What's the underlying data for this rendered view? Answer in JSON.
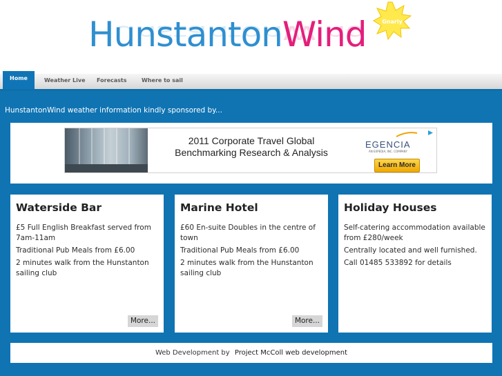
{
  "header": {
    "logo_part1": "Hunstanton",
    "logo_part2": "Wind",
    "badge": "Gnarly"
  },
  "nav": {
    "items": [
      {
        "label": "Home",
        "active": true
      },
      {
        "label": "Weather Live"
      },
      {
        "label": "Forecasts"
      },
      {
        "label": "Where to sail"
      }
    ]
  },
  "sponsor_note": "HunstantonWind weather information kindly sponsored by...",
  "ad": {
    "headline_line1": "2011 Corporate Travel Global",
    "headline_line2": "Benchmarking Research & Analysis",
    "brand": "EGENCIA",
    "brand_sub": "AN EXPEDIA, INC. COMPANY",
    "cta": "Learn More"
  },
  "cards": [
    {
      "title": "Waterside Bar",
      "lines": [
        "£5 Full English Breakfast served from 7am-11am",
        "Traditional Pub Meals from £6.00",
        "2 minutes walk from the Hunstanton sailing club"
      ],
      "more": "More..."
    },
    {
      "title": "Marine Hotel",
      "lines": [
        "£60 En-suite Doubles in the centre of town",
        "Traditional Pub Meals from £6.00",
        "2 minutes walk from the Hunstanton sailing club"
      ],
      "more": "More..."
    },
    {
      "title": "Holiday Houses",
      "lines": [
        "Self-catering accommodation available from £280/week",
        "Centrally located and well furnished.",
        "Call 01485 533892 for details"
      ]
    }
  ],
  "footer": {
    "prefix": "Web Development by",
    "link": "Project McColl web development"
  },
  "colors": {
    "brand_blue": "#1074b3",
    "logo_blue": "#2f8fd0",
    "logo_pink": "#e31f7b",
    "badge_yellow": "#ffe94d"
  }
}
